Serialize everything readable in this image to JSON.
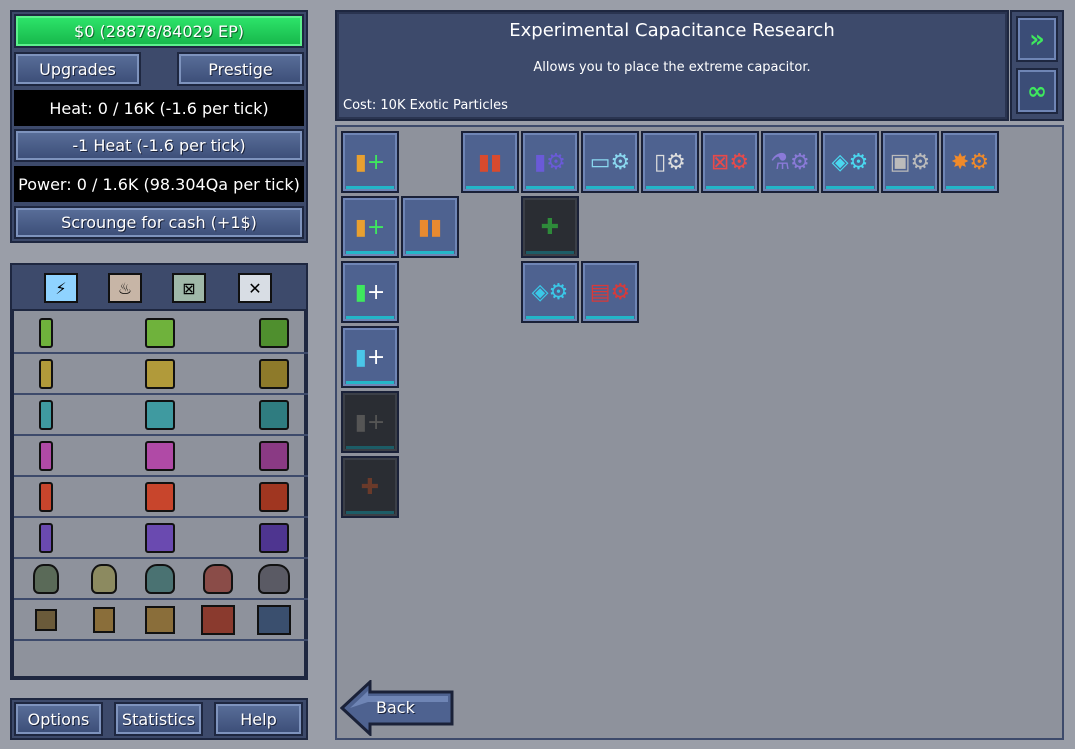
{
  "stats": {
    "money": "$0 (28878/84029 EP)",
    "heat": "Heat: 0 / 16K (-1.6 per tick)",
    "power": "Power: 0 / 1.6K (98.304Qa per tick)"
  },
  "buttons": {
    "upgrades": "Upgrades",
    "prestige": "Prestige",
    "vent_heat": "-1 Heat (-1.6 per tick)",
    "scrounge": "Scrounge for cash (+1$)",
    "options": "Options",
    "statistics": "Statistics",
    "help": "Help",
    "back": "Back"
  },
  "info": {
    "title": "Experimental Capacitance Research",
    "description": "Allows you to place the extreme capacitor.",
    "cost": "Cost: 10K Exotic Particles"
  },
  "colors": {
    "accent": "#3d4a6b",
    "money_bar": "#22d45c",
    "background": "#9a9ea8"
  },
  "icons": {
    "forward": "double-chevron-right-icon",
    "infinity": "infinity-icon"
  }
}
